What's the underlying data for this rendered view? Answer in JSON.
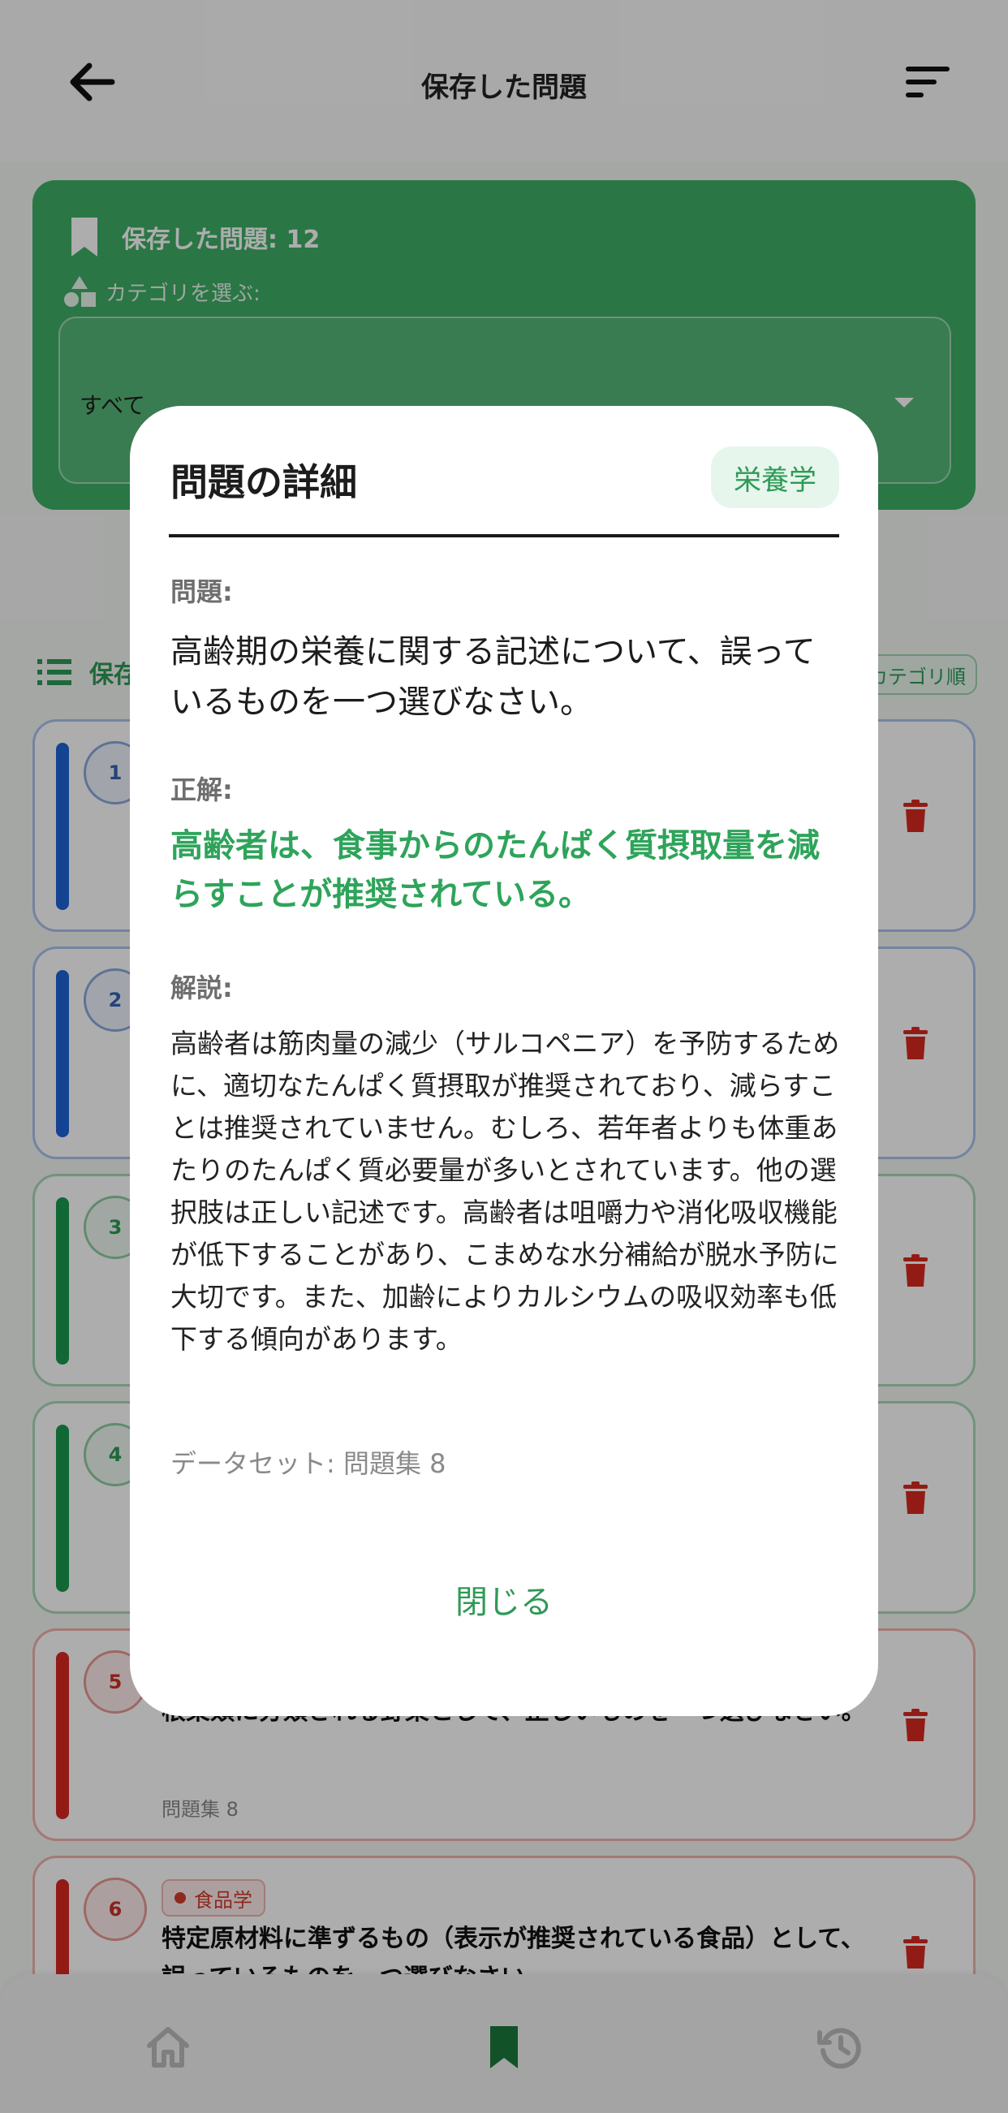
{
  "header": {
    "title": "保存した問題"
  },
  "summary": {
    "saved_count": "保存した問題: 12",
    "category_label": "カテゴリを選ぶ:",
    "category_value": "すべて"
  },
  "list": {
    "title": "保存した問題",
    "sort_label": "カテゴリ順"
  },
  "questions": [
    {
      "number": "1",
      "color": "#1e63d6"
    },
    {
      "number": "2",
      "color": "#1e63d6"
    },
    {
      "number": "3",
      "color": "#1a9a4e"
    },
    {
      "number": "4",
      "color": "#1a9a4e"
    },
    {
      "number": "5",
      "color": "#d82a20",
      "text": "根菜類に分類される野菜として、正しいものを一つ選びなさい。",
      "set": "問題集 8"
    },
    {
      "number": "6",
      "color": "#d82a20",
      "tag": "食品学",
      "text": "特定原材料に準ずるもの（表示が推奨されている食品）として、誤っているものを一つ選びなさい。"
    }
  ],
  "nav": {
    "items": [
      "home-icon",
      "bookmark-icon",
      "history-icon"
    ],
    "active": "bookmark-icon"
  },
  "modal": {
    "title": "問題の詳細",
    "category_chip": "栄養学",
    "question_label": "問題:",
    "question": "高齢期の栄養に関する記述について、誤っているものを一つ選びなさい。",
    "answer_label": "正解:",
    "answer": "高齢者は、食事からのたんぱく質摂取量を減らすことが推奨されている。",
    "explanation_label": "解説:",
    "explanation": "高齢者は筋肉量の減少（サルコペニア）を予防するために、適切なたんぱく質摂取が推奨されており、減らすことは推奨されていません。むしろ、若年者よりも体重あたりのたんぱく質必要量が多いとされています。他の選択肢は正しい記述です。高齢者は咀嚼力や消化吸収機能が低下することがあり、こまめな水分補給が脱水予防に大切です。また、加齢によりカルシウムの吸収効率も低下する傾向があります。",
    "dataset": "データセット: 問題集 8",
    "close_label": "閉じる"
  },
  "colors": {
    "accent": "#2e9a56",
    "card_green": "#3fae66",
    "delete": "#d82a20"
  }
}
